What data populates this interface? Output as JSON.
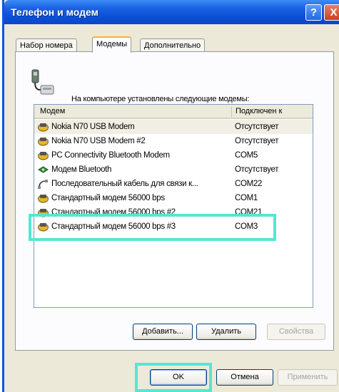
{
  "window": {
    "title": "Телефон и модем",
    "help_label": "?",
    "close_label": "X"
  },
  "tabs": [
    {
      "label": "Набор номера",
      "active": false
    },
    {
      "label": "Модемы",
      "active": true
    },
    {
      "label": "Дополнительно",
      "active": false
    }
  ],
  "intro_text": "На компьютере установлены следующие модемы:",
  "table": {
    "headers": [
      "Модем",
      "Подключен к"
    ],
    "rows": [
      {
        "name": "Nokia N70 USB Modem",
        "port": "Отсутствует",
        "icon": "modem-icon"
      },
      {
        "name": "Nokia N70 USB Modem #2",
        "port": "Отсутствует",
        "icon": "modem-icon"
      },
      {
        "name": "PC Connectivity Bluetooth Modem",
        "port": "COM5",
        "icon": "modem-icon"
      },
      {
        "name": "Модем Bluetooth",
        "port": "Отсутствует",
        "icon": "bluetooth-modem-icon"
      },
      {
        "name": "Последовательный кабель для связи к...",
        "port": "COM22",
        "icon": "serial-cable-icon"
      },
      {
        "name": "Стандартный модем 56000 bps",
        "port": "COM1",
        "icon": "modem-icon"
      },
      {
        "name": "Стандартный модем 56000 bps #2",
        "port": "COM21",
        "icon": "modem-icon"
      },
      {
        "name": "Стандартный модем 56000 bps #3",
        "port": "COM3",
        "icon": "modem-icon"
      }
    ]
  },
  "buttons": {
    "add": "Добавить...",
    "remove": "Удалить",
    "properties": "Свойства"
  },
  "footer": {
    "ok": "OK",
    "cancel": "Отмена",
    "apply": "Применить"
  },
  "colors": {
    "titlebar": "#0b4fd6",
    "highlight_box": "#55e6d3",
    "window_bg": "#ece9d8"
  }
}
